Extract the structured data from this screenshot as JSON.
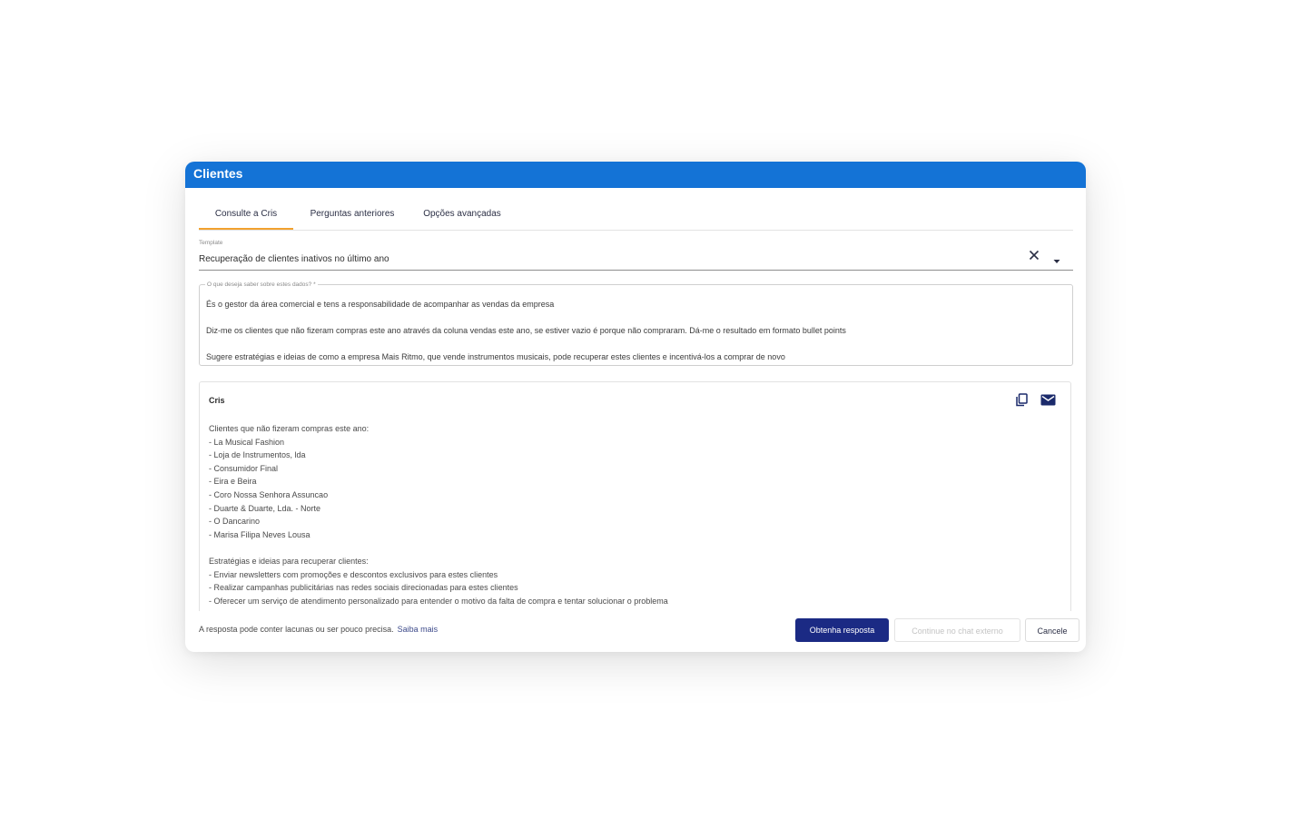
{
  "dialog": {
    "title": "Clientes"
  },
  "tabs": [
    {
      "label": "Consulte a Cris",
      "active": true
    },
    {
      "label": "Perguntas anteriores",
      "active": false
    },
    {
      "label": "Opções avançadas",
      "active": false
    }
  ],
  "template": {
    "label": "Template",
    "value": "Recuperação de clientes inativos no último ano"
  },
  "question": {
    "label": "O que deseja saber sobre estes dados? *",
    "text": "És o gestor da área comercial e tens a responsabilidade de acompanhar as vendas da empresa\n\nDiz-me os clientes que não fizeram compras este ano através da coluna vendas este ano, se estiver vazio é porque não compraram. Dá-me o resultado em formato bullet points\n\nSugere estratégias e ideias de como a empresa Mais Ritmo, que vende instrumentos musicais, pode recuperar estes clientes e incentivá-los a comprar de novo"
  },
  "answer": {
    "author": "Cris",
    "text": "Clientes que não fizeram compras este ano:\n- La Musical Fashion\n- Loja de Instrumentos, lda\n- Consumidor Final\n- Eira e Beira\n- Coro Nossa Senhora Assuncao\n- Duarte & Duarte, Lda. - Norte\n- O Dancarino\n- Marisa Filipa Neves Lousa\n\nEstratégias e ideias para recuperar clientes:\n- Enviar newsletters com promoções e descontos exclusivos para estes clientes\n- Realizar campanhas publicitárias nas redes sociais direcionadas para estes clientes\n- Oferecer um serviço de atendimento personalizado para entender o motivo da falta de compra e tentar solucionar o problema"
  },
  "footer": {
    "disclaimer": "A resposta pode conter lacunas ou ser pouco precisa.",
    "learn_more": "Saiba mais",
    "get_answer": "Obtenha resposta",
    "continue_external": "Continue no chat externo",
    "cancel": "Cancele"
  },
  "colors": {
    "header_blue": "#1473d6",
    "tab_accent": "#f2a12e",
    "primary_button": "#1b2a84",
    "icon_navy": "#1b2a6b"
  }
}
